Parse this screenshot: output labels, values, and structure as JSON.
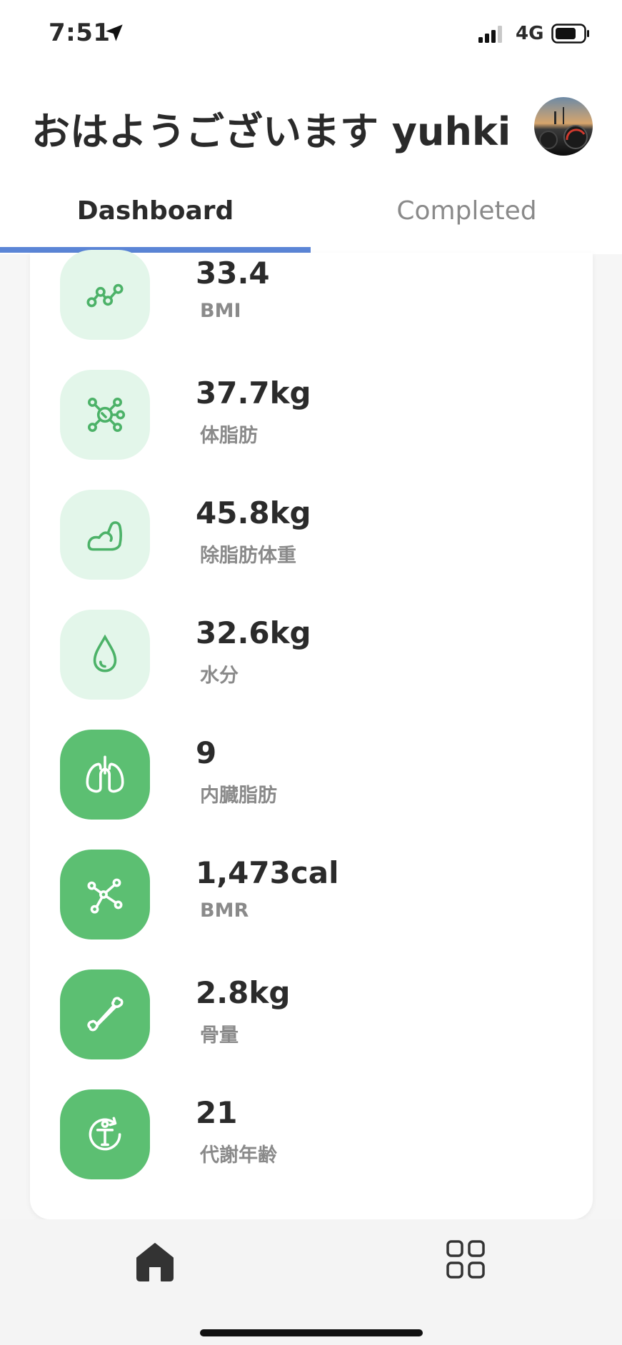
{
  "status_bar": {
    "time": "7:51",
    "network": "4G",
    "icons": [
      "location-arrow-icon",
      "signal-icon",
      "battery-icon"
    ]
  },
  "header": {
    "greeting": "おはようございます yuhki",
    "avatar_icon": "avatar"
  },
  "tabs": [
    {
      "label": "Dashboard",
      "active": true
    },
    {
      "label": "Completed",
      "active": false
    }
  ],
  "colors": {
    "accent": "#5b85d6",
    "green": "#5cbf72",
    "green_light": "#e3f6ea",
    "text": "#2b2b2b",
    "muted": "#8a8a8a"
  },
  "metrics": [
    {
      "value": "33.4",
      "label": "BMI",
      "icon": "trend-line-icon",
      "style": "light"
    },
    {
      "value": "37.7kg",
      "label": "体脂肪",
      "icon": "molecule-icon",
      "style": "light"
    },
    {
      "value": "45.8kg",
      "label": "除脂肪体重",
      "icon": "muscle-arm-icon",
      "style": "light"
    },
    {
      "value": "32.6kg",
      "label": "水分",
      "icon": "water-drop-icon",
      "style": "light"
    },
    {
      "value": "9",
      "label": "内臓脂肪",
      "icon": "lungs-icon",
      "style": "solid"
    },
    {
      "value": "1,473cal",
      "label": "BMR",
      "icon": "network-nodes-icon",
      "style": "solid"
    },
    {
      "value": "2.8kg",
      "label": "骨量",
      "icon": "bone-icon",
      "style": "solid"
    },
    {
      "value": "21",
      "label": "代謝年齢",
      "icon": "metabolic-age-icon",
      "style": "solid"
    }
  ],
  "bottom_nav": {
    "items": [
      {
        "icon": "home-icon",
        "active": true
      },
      {
        "icon": "grid-icon",
        "active": false
      }
    ]
  }
}
